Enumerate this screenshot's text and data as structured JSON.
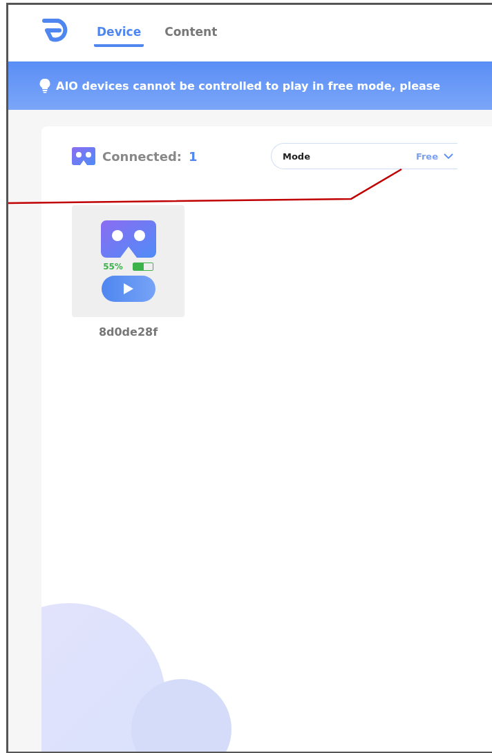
{
  "nav": {
    "tabs": [
      {
        "label": "Device",
        "selected": true
      },
      {
        "label": "Content",
        "selected": false
      }
    ]
  },
  "banner": {
    "text": "AIO devices cannot be controlled to play in free mode, please"
  },
  "panel": {
    "connected_label": "Connected:",
    "connected_count": "1",
    "mode": {
      "label": "Mode",
      "value": "Free"
    }
  },
  "devices": [
    {
      "battery_text": "55%",
      "level": 0.55,
      "name": "8d0de28f"
    }
  ]
}
